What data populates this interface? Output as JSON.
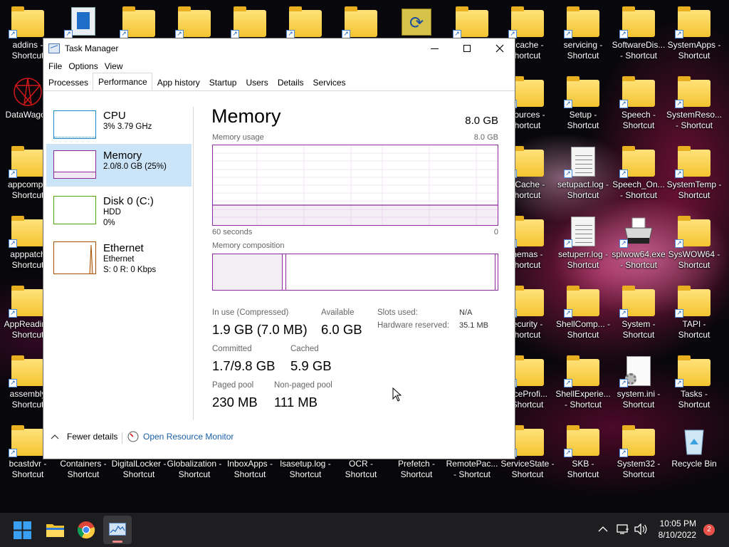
{
  "desktop": {
    "icons": [
      {
        "label": "addins - Shortcut",
        "type": "folder"
      },
      {
        "label": "",
        "type": "app"
      },
      {
        "label": "",
        "type": "folder"
      },
      {
        "label": "",
        "type": "folder"
      },
      {
        "label": "",
        "type": "folder"
      },
      {
        "label": "",
        "type": "folder"
      },
      {
        "label": "",
        "type": "folder"
      },
      {
        "label": "",
        "type": "sync"
      },
      {
        "label": "",
        "type": "folder"
      },
      {
        "label": "scache - hortcut",
        "type": "folder"
      },
      {
        "label": "servicing - Shortcut",
        "type": "folder"
      },
      {
        "label": "SoftwareDis... - Shortcut",
        "type": "folder"
      },
      {
        "label": "SystemApps - Shortcut",
        "type": "folder"
      },
      {
        "label": "DataWagon",
        "type": "star"
      },
      {
        "label": "sources - hortcut",
        "type": "folder"
      },
      {
        "label": "Setup - Shortcut",
        "type": "folder"
      },
      {
        "label": "Speech - Shortcut",
        "type": "folder"
      },
      {
        "label": "SystemReso... - Shortcut",
        "type": "folder"
      },
      {
        "label": "appcompa Shortcut",
        "type": "folder"
      },
      {
        "label": "nCache - hortcut",
        "type": "folder"
      },
      {
        "label": "setupact.log - Shortcut",
        "type": "doc"
      },
      {
        "label": "Speech_On... - Shortcut",
        "type": "folder"
      },
      {
        "label": "SystemTemp - Shortcut",
        "type": "folder"
      },
      {
        "label": "apppatch Shortcut",
        "type": "folder"
      },
      {
        "label": "hemas - hortcut",
        "type": "folder"
      },
      {
        "label": "setuperr.log - Shortcut",
        "type": "doc"
      },
      {
        "label": "splwow64.exe - Shortcut",
        "type": "printer"
      },
      {
        "label": "SysWOW64 - Shortcut",
        "type": "folder"
      },
      {
        "label": "AppReadin - Shortcut",
        "type": "folder"
      },
      {
        "label": "ecurity - hortcut",
        "type": "folder"
      },
      {
        "label": "ShellComp... - Shortcut",
        "type": "folder"
      },
      {
        "label": "System - Shortcut",
        "type": "folder"
      },
      {
        "label": "TAPI - Shortcut",
        "type": "folder"
      },
      {
        "label": "assembly Shortcut",
        "type": "folder"
      },
      {
        "label": "viceProfi... Shortcut",
        "type": "folder"
      },
      {
        "label": "ShellExperie... - Shortcut",
        "type": "folder"
      },
      {
        "label": "system.ini - Shortcut",
        "type": "ini"
      },
      {
        "label": "Tasks - Shortcut",
        "type": "folder"
      },
      {
        "label": "bcastdvr - Shortcut",
        "type": "folder"
      },
      {
        "label": "Containers - Shortcut",
        "type": "folder"
      },
      {
        "label": "DigitalLocker - Shortcut",
        "type": "folder"
      },
      {
        "label": "Globalization - Shortcut",
        "type": "folder"
      },
      {
        "label": "InboxApps - Shortcut",
        "type": "folder"
      },
      {
        "label": "lsasetup.log - Shortcut",
        "type": "folder"
      },
      {
        "label": "OCR - Shortcut",
        "type": "folder"
      },
      {
        "label": "Prefetch - Shortcut",
        "type": "folder"
      },
      {
        "label": "RemotePac... - Shortcut",
        "type": "folder"
      },
      {
        "label": "ServiceState - Shortcut",
        "type": "folder"
      },
      {
        "label": "SKB - Shortcut",
        "type": "folder"
      },
      {
        "label": "System32 - Shortcut",
        "type": "folder"
      },
      {
        "label": "Recycle Bin",
        "type": "recycle"
      }
    ]
  },
  "window": {
    "title": "Task Manager",
    "minimize_icon": "minimize-icon",
    "maximize_icon": "maximize-icon",
    "close_icon": "close-icon"
  },
  "menu": [
    "File",
    "Options",
    "View"
  ],
  "tabs": [
    "Processes",
    "Performance",
    "App history",
    "Startup",
    "Users",
    "Details",
    "Services"
  ],
  "active_tab": "Performance",
  "resources": [
    {
      "name": "CPU",
      "line1": "3%  3.79 GHz",
      "line2": "",
      "color": "#1b8ac8"
    },
    {
      "name": "Memory",
      "line1": "2.0/8.0 GB (25%)",
      "line2": "",
      "color": "#8b2b9e"
    },
    {
      "name": "Disk 0 (C:)",
      "line1": "HDD",
      "line2": "0%",
      "color": "#4da60c"
    },
    {
      "name": "Ethernet",
      "line1": "Ethernet",
      "line2": "S: 0  R: 0 Kbps",
      "color": "#a74f01"
    }
  ],
  "memory": {
    "title": "Memory",
    "total": "8.0 GB",
    "usage_label": "Memory usage",
    "usage_max": "8.0 GB",
    "time_left": "60 seconds",
    "time_right": "0",
    "composition_label": "Memory composition",
    "usage_fraction": 0.25,
    "composition_in_use_fraction": 0.245,
    "in_use_label": "In use (Compressed)",
    "in_use_value": "1.9 GB (7.0 MB)",
    "available_label": "Available",
    "available_value": "6.0 GB",
    "committed_label": "Committed",
    "committed_value": "1.7/9.8 GB",
    "cached_label": "Cached",
    "cached_value": "5.9 GB",
    "paged_label": "Paged pool",
    "paged_value": "230 MB",
    "nonpaged_label": "Non-paged pool",
    "nonpaged_value": "111 MB",
    "slots_label": "Slots used:",
    "slots_value": "N/A",
    "hw_label": "Hardware reserved:",
    "hw_value": "35.1 MB"
  },
  "footer": {
    "fewer_details": "Fewer details",
    "resource_monitor": "Open Resource Monitor"
  },
  "taskbar": {
    "time": "10:05 PM",
    "date": "8/10/2022",
    "notification_count": "2",
    "accent": "#0078d4"
  }
}
